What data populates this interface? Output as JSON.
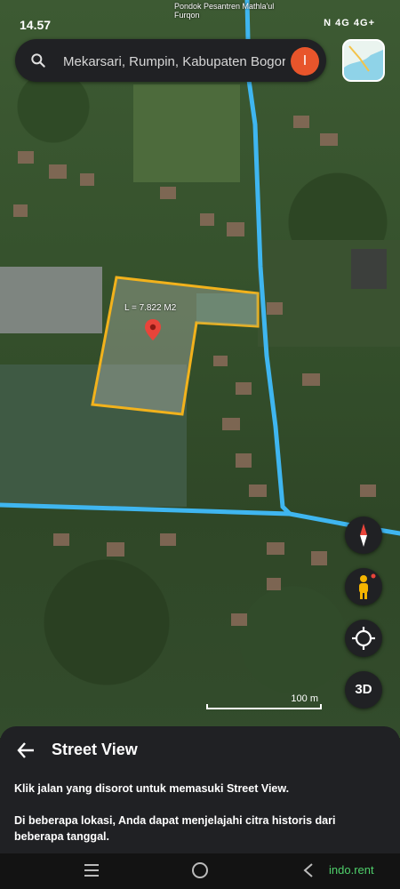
{
  "status_bar": {
    "time": "14.57",
    "poi_label": "Pondok Pesantren Mathla'ul Furqon",
    "system_text": "N 4G 4G+"
  },
  "search": {
    "value": "Mekarsari, Rumpin, Kabupaten Bogor"
  },
  "account": {
    "initial": "I",
    "color": "#e8552b"
  },
  "map": {
    "area_label": "L = 7.822 M2",
    "scale_label": "100 m",
    "street_view_line_color": "#3fb6f0",
    "polygon_color": "#f2b21c"
  },
  "controls": {
    "compass": "compass-icon",
    "street_view": "pegman-icon",
    "location": "my-location-icon",
    "three_d_label": "3D"
  },
  "sheet": {
    "title": "Street View",
    "paragraph_1": "Klik jalan yang disorot untuk memasuki Street View.",
    "paragraph_2": "Di beberapa lokasi, Anda dapat menjelajahi citra historis dari beberapa tanggal."
  },
  "nav": {
    "brand": "indo.rent"
  }
}
